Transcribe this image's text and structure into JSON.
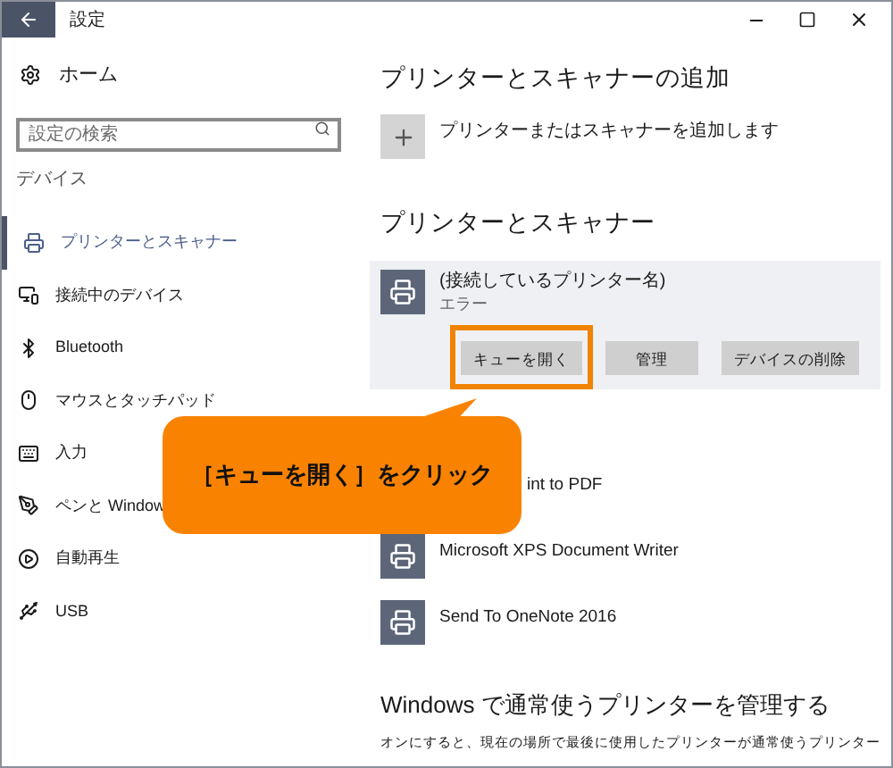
{
  "window": {
    "title": "設定"
  },
  "sidebar": {
    "home": "ホーム",
    "search": {
      "placeholder": "設定の検索"
    },
    "section": "デバイス",
    "items": [
      {
        "label": "プリンターとスキャナー",
        "selected": true
      },
      {
        "label": "接続中のデバイス",
        "selected": false
      },
      {
        "label": "Bluetooth",
        "selected": false
      },
      {
        "label": "マウスとタッチパッド",
        "selected": false
      },
      {
        "label": "入力",
        "selected": false
      },
      {
        "label": "ペンと Window",
        "selected": false
      },
      {
        "label": "自動再生",
        "selected": false
      },
      {
        "label": "USB",
        "selected": false
      }
    ]
  },
  "main": {
    "add_heading": "プリンターとスキャナーの追加",
    "add_label": "プリンターまたはスキャナーを追加します",
    "list_heading": "プリンターとスキャナー",
    "selected_printer": {
      "name": "(接続しているプリンター名)",
      "status": "エラー",
      "buttons": [
        {
          "label": "キューを開く",
          "highlighted": true
        },
        {
          "label": "管理",
          "highlighted": false
        },
        {
          "label": "デバイスの削除",
          "highlighted": false
        }
      ]
    },
    "printers": [
      {
        "name": "int to PDF",
        "icon_hidden": true
      },
      {
        "name": "Microsoft XPS Document Writer",
        "icon_hidden": false
      },
      {
        "name": "Send To OneNote 2016",
        "icon_hidden": false
      }
    ],
    "default_heading": "Windows で通常使うプリンターを管理する",
    "default_text": "オンにすると、現在の場所で最後に使用したプリンターが通常使うプリンター"
  },
  "callout": {
    "text": "［キューを開く］をクリック"
  }
}
